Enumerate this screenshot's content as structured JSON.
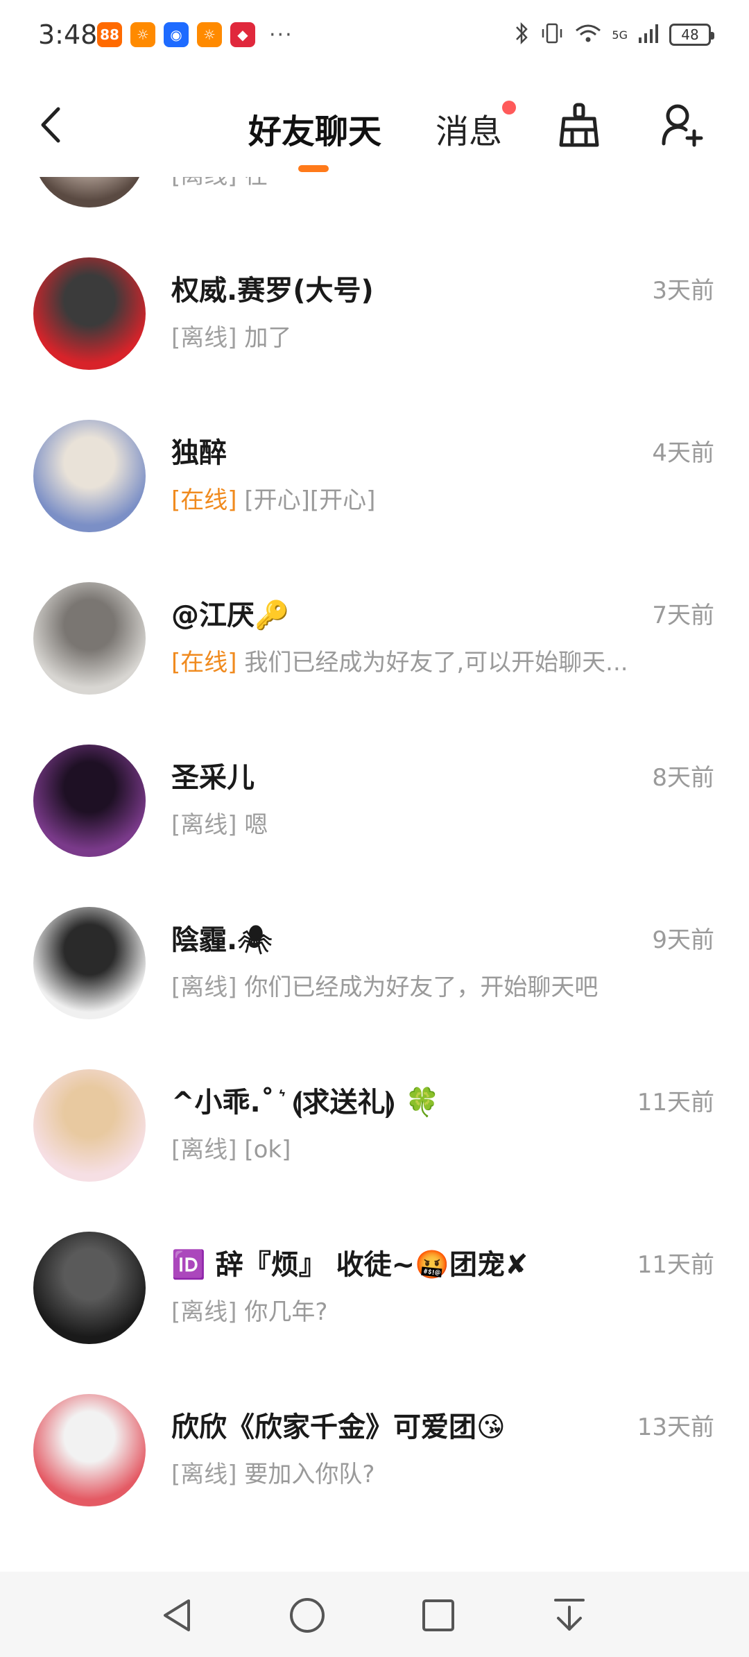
{
  "status_bar": {
    "time": "3:48",
    "dots": "···",
    "signal_label": "5G",
    "battery": "48",
    "app_icons": [
      {
        "name": "app-icon-1",
        "color": "#ff6a00",
        "glyph": "88"
      },
      {
        "name": "app-icon-2",
        "color": "#ff8a00",
        "glyph": "☼"
      },
      {
        "name": "app-icon-3",
        "color": "#1e6bff",
        "glyph": "◉"
      },
      {
        "name": "app-icon-4",
        "color": "#ff8a00",
        "glyph": "☼"
      },
      {
        "name": "app-icon-5",
        "color": "#e0283c",
        "glyph": "◆"
      }
    ]
  },
  "header": {
    "active_tab": "好友聊天",
    "messages_tab": "消息",
    "accent_color": "#ff7a1a"
  },
  "conversations": [
    {
      "name": "",
      "time": "",
      "status": "[离线]",
      "online": false,
      "preview": "在",
      "avatar_colors": [
        "#5a4a42",
        "#c9b8ad"
      ]
    },
    {
      "name": "权威.赛罗(大号)",
      "time": "3天前",
      "status": "[离线]",
      "online": false,
      "preview": "加了",
      "avatar_colors": [
        "#d8232a",
        "#3b3b3b"
      ]
    },
    {
      "name": "独醉",
      "time": "4天前",
      "status": "[在线]",
      "online": true,
      "preview": "[开心][开心]",
      "avatar_colors": [
        "#7b8fc6",
        "#e9e2d8"
      ]
    },
    {
      "name": "@江厌🔑",
      "time": "7天前",
      "status": "[在线]",
      "online": true,
      "preview": "我们已经成为好友了,可以开始聊天...",
      "avatar_colors": [
        "#d8d6d2",
        "#7a7672"
      ]
    },
    {
      "name": "圣采儿",
      "time": "8天前",
      "status": "[离线]",
      "online": false,
      "preview": "嗯",
      "avatar_colors": [
        "#7a3a8a",
        "#1e1024"
      ]
    },
    {
      "name": "陰霾.🕷",
      "time": "9天前",
      "status": "[离线]",
      "online": false,
      "preview": "你们已经成为好友了，开始聊天吧",
      "avatar_colors": [
        "#f0f0f0",
        "#2a2a2a"
      ]
    },
    {
      "name": "^小乖.˚ ͛ ⟬求送礼⟭ 🍀",
      "time": "11天前",
      "status": "[离线]",
      "online": false,
      "preview": "[ok]",
      "avatar_colors": [
        "#f6dfe4",
        "#e8c9a0"
      ]
    },
    {
      "name": "🆔 辞『烦』 收徒~🤬团宠✘",
      "time": "11天前",
      "status": "[离线]",
      "online": false,
      "preview": "你几年?",
      "avatar_colors": [
        "#1a1a1a",
        "#5a5a5a"
      ]
    },
    {
      "name": "欣欣《欣家千金》可爱团😘",
      "time": "13天前",
      "status": "[离线]",
      "online": false,
      "preview": "要加入你队?",
      "avatar_colors": [
        "#e45a64",
        "#f2f2f2"
      ]
    }
  ]
}
